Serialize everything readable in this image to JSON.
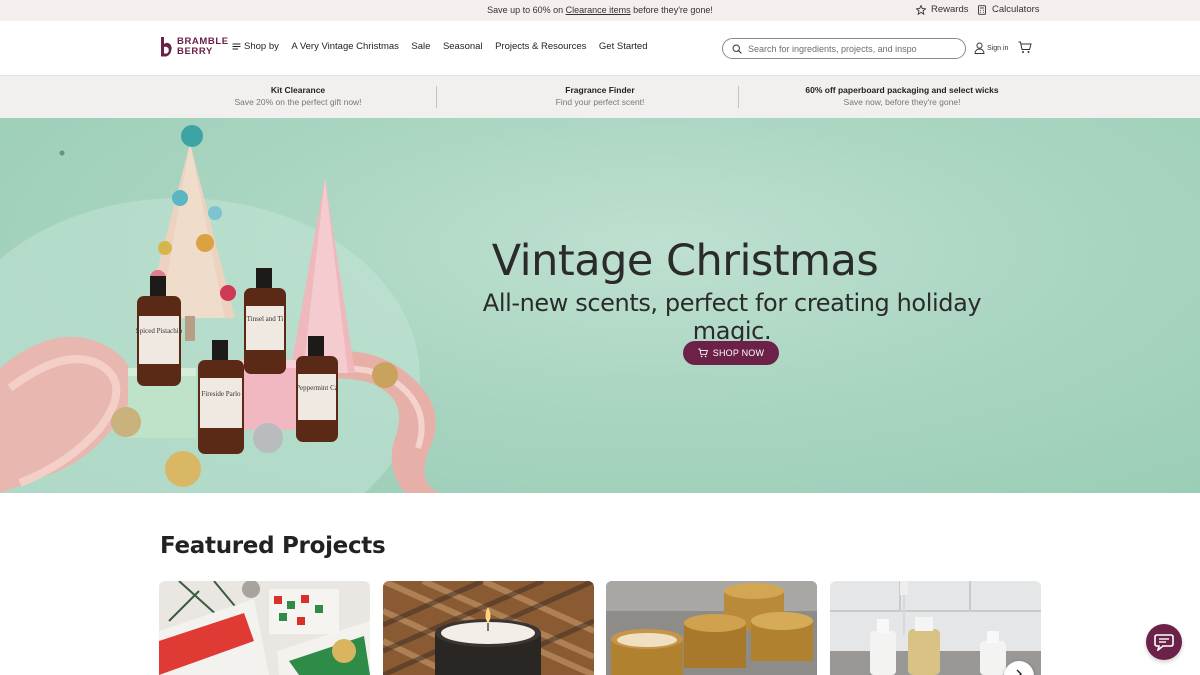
{
  "announcement": {
    "prefix": "Save up to 60% on ",
    "link": "Clearance items",
    "suffix": " before they're gone!",
    "rewards": "Rewards",
    "calculators": "Calculators"
  },
  "header": {
    "logo_line1": "BRAMBLE",
    "logo_line2": "BERRY",
    "nav": [
      "Shop by",
      "A Very Vintage Christmas",
      "Sale",
      "Seasonal",
      "Projects & Resources",
      "Get Started"
    ],
    "search_placeholder": "Search for ingredients, projects, and inspo",
    "sign_in": "Sign in"
  },
  "promos": [
    {
      "title": "Kit Clearance",
      "subtitle": "Save 20% on the perfect gift now!"
    },
    {
      "title": "Fragrance Finder",
      "subtitle": "Find your perfect scent!"
    },
    {
      "title": "60% off paperboard packaging and select wicks",
      "subtitle": "Save now, before they're gone!"
    }
  ],
  "hero": {
    "title": "Vintage Christmas",
    "subtitle": "All-new scents, perfect for creating holiday magic.",
    "button": "SHOP NOW",
    "bottle_labels": [
      "Spiced Pistachio",
      "Tinsel and Ti",
      "Fireside Parlo",
      "Peppermint Ca"
    ]
  },
  "featured": {
    "title": "Featured Projects"
  },
  "colors": {
    "brand_plum": "#6c2248",
    "hero_mint": "#a9d5c1",
    "promo_bg": "#f2f0ee"
  },
  "icons": {
    "rewards": "star-icon",
    "calculators": "calculator-icon",
    "menu": "menu-icon",
    "search": "search-icon",
    "account": "user-icon",
    "cart": "cart-icon",
    "chat": "chat-icon",
    "next": "chevron-right-icon"
  }
}
